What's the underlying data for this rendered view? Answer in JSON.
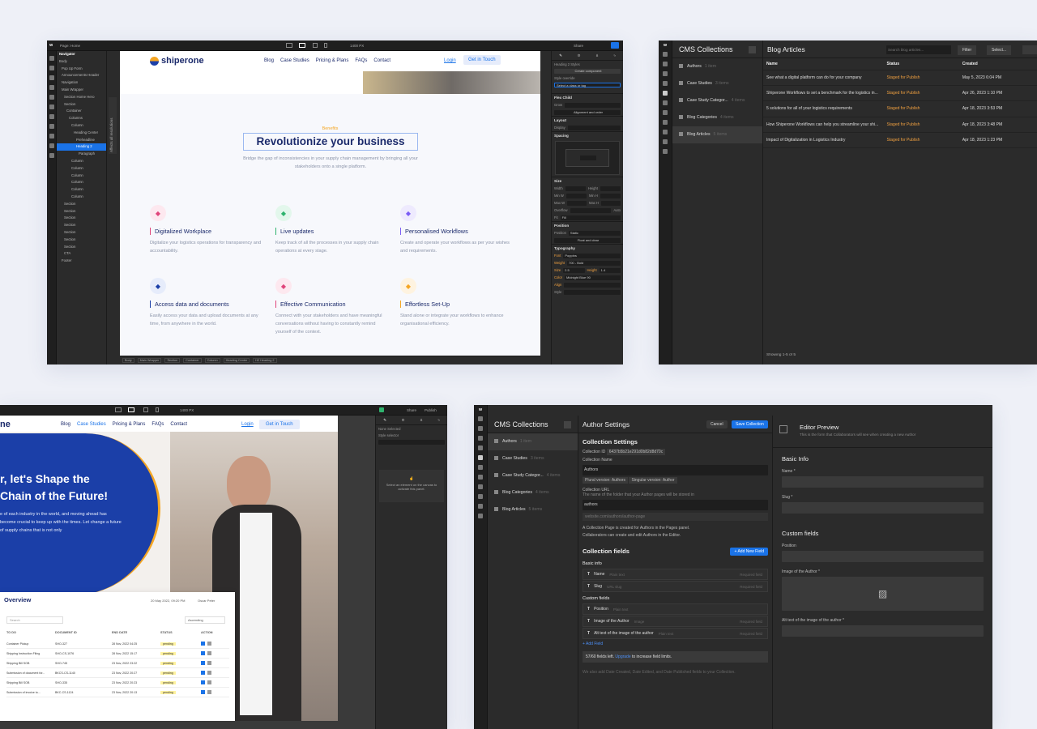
{
  "designer": {
    "page_label": "Page: Home",
    "width_label": "1400 PX",
    "share_label": "Share",
    "navigator": {
      "title": "Navigator",
      "items": [
        "Body",
        "Pop Up Form",
        "Announcements Header",
        "Navigation",
        "Main Wrapper",
        "Section Home Hero",
        "Section",
        "Container",
        "Columns",
        "Column",
        "Heading Center",
        "Preheadline",
        "Heading 2",
        "Paragraph",
        "Column",
        "Column",
        "Column",
        "Column",
        "Column",
        "Column",
        "Section",
        "Section",
        "Section",
        "Section",
        "Section",
        "Section",
        "Section",
        "CTA",
        "Footer"
      ],
      "selected_index": 12
    },
    "side_label": "Desktop",
    "side_label2": "Affects all resolutions",
    "site": {
      "logo": "shiperone",
      "nav": [
        "Blog",
        "Case Studies",
        "Pricing & Plans",
        "FAQs",
        "Contact"
      ],
      "login": "Login",
      "cta": "Get in Touch",
      "eyebrow": "Benefits",
      "heading": "Revolutionize your business",
      "subheading": "Bridge the gap of inconsistencies in your supply chain management by bringing all your stakeholders onto a single platform.",
      "cards": [
        {
          "title": "Digitalized Workplace",
          "desc": "Digitalize your logistics operations for transparency and accountability.",
          "color": "#e0457b",
          "bg": "#fde8ef"
        },
        {
          "title": "Live updates",
          "desc": "Keep track of all the processes in your supply chain operations at every stage.",
          "color": "#2fb36e",
          "bg": "#e3f7ec"
        },
        {
          "title": "Personalised Workflows",
          "desc": "Create and operate your workflows as per your wishes and requirements.",
          "color": "#7b5cf5",
          "bg": "#eeeafe"
        },
        {
          "title": "Access data and documents",
          "desc": "Easily access your data and upload documents at any time, from anywhere in the world.",
          "color": "#1b3fa8",
          "bg": "#e6ecfb"
        },
        {
          "title": "Effective Communication",
          "desc": "Connect with your stakeholders and have meaningful conversations without having to constantly remind yourself of the context.",
          "color": "#e0457b",
          "bg": "#fde8ef"
        },
        {
          "title": "Effortless Set-Up",
          "desc": "Stand alone or integrate your workflows to enhance organisational efficiency.",
          "color": "#f5a623",
          "bg": "#fef3e0"
        }
      ]
    },
    "breadcrumbs": [
      "Body",
      "Main Wrapper",
      "Section",
      "Container",
      "Column",
      "Heading Center",
      "H2 Heading 2"
    ],
    "style_panel": {
      "styles_label": "Heading 2 Styles",
      "create_component": "Create component",
      "style_override": "Style override",
      "selector_placeholder": "Select a class or tag",
      "flex_child": "Flex Child",
      "grow": "Grow",
      "alignment": "Alignment and order",
      "layout": "Layout",
      "display": "Display",
      "spacing": "Spacing",
      "size": "Size",
      "width": "Width",
      "height": "Height",
      "min_w": "Min W",
      "min_h": "Min H",
      "max_w": "Max W",
      "max_h": "Max H",
      "overflow": "Overflow",
      "fit": "Fit",
      "fit_value": "Fill",
      "auto": "Auto",
      "position": "Position",
      "position_value": "Static",
      "float_clear": "Float and clear",
      "typography": "Typography",
      "font": "Font",
      "font_value": "Poppins",
      "weight": "Weight",
      "weight_value": "700 - Bold",
      "size_label": "Size",
      "size_value": "2.5",
      "height_value": "1.4",
      "color": "Color",
      "color_value": "Midnight Blue 90",
      "align": "Align",
      "style": "Style",
      "mixed": "Mixed",
      "none": "None"
    }
  },
  "cms_list": {
    "title": "CMS Collections",
    "collections": [
      {
        "name": "Authors",
        "count": "1 item"
      },
      {
        "name": "Case Studies",
        "count": "3 items"
      },
      {
        "name": "Case Study Categor...",
        "count": "4 items"
      },
      {
        "name": "Blog Categories",
        "count": "4 items"
      },
      {
        "name": "Blog Articles",
        "count": "5 items"
      }
    ],
    "articles_title": "Blog Articles",
    "search_placeholder": "Search blog articles...",
    "filter": "Filter",
    "select": "Select...",
    "columns": [
      "Name",
      "Status",
      "Created"
    ],
    "rows": [
      {
        "name": "See what a digital platform can do for your company",
        "status": "Staged for Publish",
        "created": "May 5, 2023 6:04 PM"
      },
      {
        "name": "Shiperone Workflows to set a benchmark for the logistics in...",
        "status": "Staged for Publish",
        "created": "Apr 26, 2023 1:10 PM"
      },
      {
        "name": "5 solutions for all of your logistics requirements",
        "status": "Staged for Publish",
        "created": "Apr 18, 2023 3:53 PM"
      },
      {
        "name": "How Shiperone Workflows can help you streamline your shi...",
        "status": "Staged for Publish",
        "created": "Apr 18, 2023 3:48 PM"
      },
      {
        "name": "Impact of Digitalization in Logistics Industry",
        "status": "Staged for Publish",
        "created": "Apr 18, 2023 1:23 PM"
      }
    ],
    "footer": "Showing 1-5 of 5"
  },
  "hero_designer": {
    "width_label": "1400 PX",
    "share_label": "Share",
    "publish_label": "Publish",
    "site": {
      "logo": "ne",
      "nav": [
        "Blog",
        "Case Studies",
        "Pricing & Plans",
        "FAQs",
        "Contact"
      ],
      "login": "Login",
      "cta": "Get in Touch",
      "headline_1": "r, let's Shape the",
      "headline_2": "Chain of the Future!",
      "body": "e of each industry in the world, and moving ahead has become crucial to keep up with the times. Let change a future of supply chains that is not only"
    },
    "dashboard": {
      "title": "Overview",
      "date": "20 May 2022, 09:20 PM",
      "user": "Oscar Peter",
      "search": "Search",
      "sort": "Ascending",
      "columns": [
        "TO DO",
        "DOCUMENT ID",
        "END DATE",
        "STATUS",
        "ACTION"
      ],
      "rows": [
        {
          "todo": "Container Pickup",
          "doc": "SHO-327",
          "date": "28 Nov, 2022 04:25",
          "status": "pending"
        },
        {
          "todo": "Shipping Instruction Filing",
          "doc": "SHO-CS-1076",
          "date": "28 Nov, 2022 15:17",
          "status": "pending"
        },
        {
          "todo": "Shipping Bill SOB",
          "doc": "SHO-745",
          "date": "23 Nov, 2022 23:22",
          "status": "pending"
        },
        {
          "todo": "Submission of document for...",
          "doc": "BKCS-CS-1140",
          "date": "23 Nov, 2022 20:27",
          "status": "pending"
        },
        {
          "todo": "Shipping Bill SOB",
          "doc": "SHO-335",
          "date": "23 Nov, 2022 20:23",
          "status": "pending"
        },
        {
          "todo": "Submission of invoice to...",
          "doc": "BKC-CS-1124",
          "date": "23 Nov, 2022 20:13",
          "status": "pending"
        }
      ]
    },
    "style_panel": {
      "none_selected": "None Selected",
      "style_selector": "Style selector",
      "empty_msg": "Select an element on the canvas to activate this panel."
    }
  },
  "cms_settings": {
    "title": "CMS Collections",
    "collections": [
      {
        "name": "Authors",
        "count": "1 item"
      },
      {
        "name": "Case Studies",
        "count": "3 items"
      },
      {
        "name": "Case Study Categor...",
        "count": "4 items"
      },
      {
        "name": "Blog Categories",
        "count": "4 items"
      },
      {
        "name": "Blog Articles",
        "count": "5 items"
      }
    ],
    "header": "Author Settings",
    "cancel": "Cancel",
    "save": "Save Collection",
    "settings_title": "Collection Settings",
    "id_label": "Collection ID",
    "id_value": "6437b5b21e291d0b82d8d70c",
    "name_label": "Collection Name",
    "name_value": "Authors",
    "plural_label": "Plural version:",
    "plural_value": "Authors",
    "singular_label": "Singular version:",
    "singular_value": "Author",
    "url_label": "Collection URL",
    "url_help": "The name of the folder that your Author pages will be stored in",
    "url_value": "authors",
    "url_preview": "website.com/authors/author-page",
    "info_1": "A Collection Page is created for Authors in the Pages panel.",
    "info_2": "Collaborators can create and edit Authors in the Editor.",
    "fields_title": "Collection fields",
    "add_field": "+ Add New Field",
    "basic_info": "Basic info",
    "basic_fields": [
      {
        "name": "Name",
        "type": "Plain text",
        "req": "Required field"
      },
      {
        "name": "Slug",
        "type": "URL slug",
        "req": "Required field"
      }
    ],
    "custom_title": "Custom fields",
    "custom_fields": [
      {
        "name": "Position",
        "type": "Plain text",
        "req": ""
      },
      {
        "name": "Image of the Author",
        "type": "Image",
        "req": "Required field"
      },
      {
        "name": "Alt text of the image of the author",
        "type": "Plain text",
        "req": "Required field"
      }
    ],
    "add_small": "+ Add Field",
    "limit_text": "57/60 fields left.",
    "limit_upgrade": "Upgrade",
    "limit_tail": "to increase field limits.",
    "footer_note": "We also add Date Created, Date Edited, and Date Published fields to your Collection.",
    "preview_title": "Editor Preview",
    "preview_sub": "This is the form that Collaborators will see when creating a new Author",
    "p_basic": "Basic Info",
    "p_name": "Name *",
    "p_slug": "Slug *",
    "p_custom": "Custom fields",
    "p_position": "Position",
    "p_image": "Image of the Author *",
    "p_alt": "Alt text of the image of the author *"
  }
}
